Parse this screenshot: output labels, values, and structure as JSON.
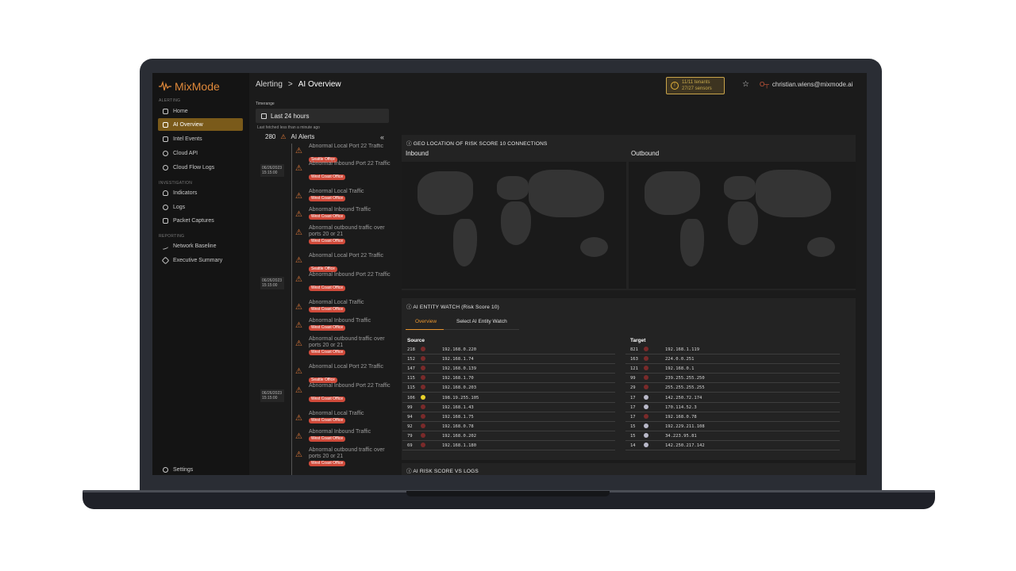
{
  "sidebar": {
    "logo": "MixMode",
    "sections": {
      "alerting": "ALERTING",
      "investigation": "INVESTIGATION",
      "reporting": "REPORTING"
    },
    "items": [
      {
        "label": "Home"
      },
      {
        "label": "AI Overview"
      },
      {
        "label": "Intel Events"
      },
      {
        "label": "Cloud API"
      },
      {
        "label": "Cloud Flow Logs"
      },
      {
        "label": "Indicators"
      },
      {
        "label": "Logs"
      },
      {
        "label": "Packet Captures"
      },
      {
        "label": "Network Baseline"
      },
      {
        "label": "Executive Summary"
      }
    ],
    "settings": "Settings"
  },
  "header": {
    "breadcrumb_parent": "Alerting",
    "breadcrumb_sep": ">",
    "breadcrumb_current": "AI Overview",
    "tenants": "11/11 tenants",
    "sensors": "27/27 sensors",
    "user": "christian.wiens@mixmode.ai"
  },
  "alerts_panel": {
    "timerange_label": "Timerange",
    "timerange_value": "Last 24 hours",
    "fetched": "Last fetched less than a minute ago",
    "count": "280",
    "count_label": "AI Alerts",
    "collapse_icon": "«",
    "dates": [
      "06/26/2023\n15:15:00",
      "06/26/2023\n15:15:00",
      "06/26/2023\n15:15:00"
    ],
    "items": [
      {
        "title": "Abnormal Local Port 22 Traffic",
        "tag": "Seattle Office"
      },
      {
        "title": "Abnormal Inbound Port 22 Traffic",
        "tag": "West Coast Office"
      },
      {
        "title": "Abnormal Local Traffic",
        "tag": "West Coast Office"
      },
      {
        "title": "Abnormal Inbound Traffic",
        "tag": "West Coast Office"
      },
      {
        "title": "Abnormal outbound traffic over ports 20 or 21",
        "tag": "West Coast Office"
      },
      {
        "title": "Abnormal Local Port 22 Traffic",
        "tag": "Seattle Office"
      },
      {
        "title": "Abnormal Inbound Port 22 Traffic",
        "tag": "West Coast Office"
      },
      {
        "title": "Abnormal Local Traffic",
        "tag": "West Coast Office"
      },
      {
        "title": "Abnormal Inbound Traffic",
        "tag": "West Coast Office"
      },
      {
        "title": "Abnormal outbound traffic over ports 20 or 21",
        "tag": "West Coast Office"
      },
      {
        "title": "Abnormal Local Port 22 Traffic",
        "tag": "Seattle Office"
      },
      {
        "title": "Abnormal Inbound Port 22 Traffic",
        "tag": "West Coast Office"
      },
      {
        "title": "Abnormal Local Traffic",
        "tag": "West Coast Office"
      },
      {
        "title": "Abnormal Inbound Traffic",
        "tag": "West Coast Office"
      },
      {
        "title": "Abnormal outbound traffic over ports 20 or 21",
        "tag": "West Coast Office"
      }
    ]
  },
  "geo": {
    "title": "GEO LOCATION OF RISK SCORE 10 CONNECTIONS",
    "inbound": "Inbound",
    "outbound": "Outbound"
  },
  "entity_watch": {
    "title": "AI ENTITY WATCH (Risk Score 10)",
    "tabs": [
      "Overview",
      "Select AI Entity Watch"
    ],
    "source_label": "Source",
    "target_label": "Target",
    "source": [
      {
        "count": "218",
        "ip": "192.168.0.220",
        "color": "#7a2a2a"
      },
      {
        "count": "152",
        "ip": "192.168.1.74",
        "color": "#7a2a2a"
      },
      {
        "count": "147",
        "ip": "192.168.0.139",
        "color": "#7a2a2a"
      },
      {
        "count": "115",
        "ip": "192.168.1.70",
        "color": "#7a2a2a"
      },
      {
        "count": "115",
        "ip": "192.168.0.203",
        "color": "#7a2a2a"
      },
      {
        "count": "106",
        "ip": "198.19.255.105",
        "color": "#e8d22a"
      },
      {
        "count": "99",
        "ip": "192.168.1.43",
        "color": "#7a2a2a"
      },
      {
        "count": "94",
        "ip": "192.168.1.75",
        "color": "#7a2a2a"
      },
      {
        "count": "92",
        "ip": "192.168.0.78",
        "color": "#7a2a2a"
      },
      {
        "count": "79",
        "ip": "192.168.0.202",
        "color": "#7a2a2a"
      },
      {
        "count": "69",
        "ip": "192.168.1.180",
        "color": "#7a2a2a"
      }
    ],
    "target": [
      {
        "count": "821",
        "ip": "192.168.1.119",
        "color": "#7a2a2a"
      },
      {
        "count": "163",
        "ip": "224.0.0.251",
        "color": "#7a2a2a"
      },
      {
        "count": "121",
        "ip": "192.168.0.1",
        "color": "#7a2a2a"
      },
      {
        "count": "99",
        "ip": "239.255.255.250",
        "color": "#7a2a2a"
      },
      {
        "count": "29",
        "ip": "255.255.255.255",
        "color": "#7a2a2a"
      },
      {
        "count": "17",
        "ip": "142.250.72.174",
        "color": "#b8b8c8"
      },
      {
        "count": "17",
        "ip": "170.114.52.3",
        "color": "#b8b8c8"
      },
      {
        "count": "17",
        "ip": "192.168.0.78",
        "color": "#7a2a2a"
      },
      {
        "count": "15",
        "ip": "192.229.211.108",
        "color": "#b8b8c8"
      },
      {
        "count": "15",
        "ip": "34.223.95.81",
        "color": "#b8b8c8"
      },
      {
        "count": "14",
        "ip": "142.250.217.142",
        "color": "#b8b8c8"
      }
    ]
  },
  "risk_vs_logs": {
    "title": "AI RISK SCORE VS LOGS"
  }
}
